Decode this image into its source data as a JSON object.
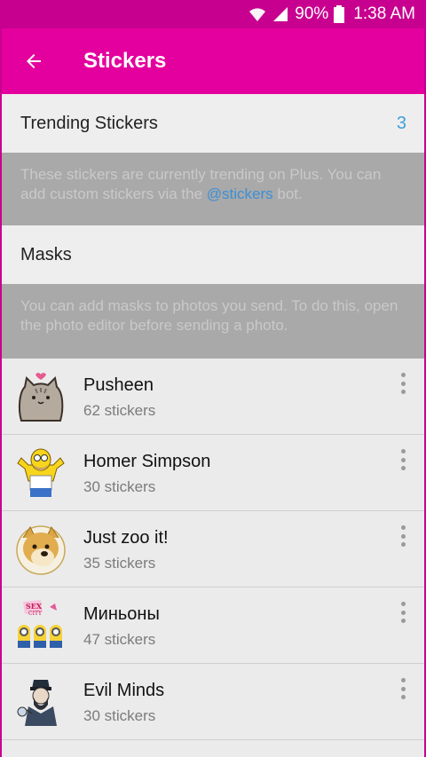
{
  "status": {
    "battery": "90%",
    "time": "1:38 AM"
  },
  "appbar": {
    "title": "Stickers"
  },
  "trending": {
    "label": "Trending Stickers",
    "count": "3"
  },
  "trending_info": {
    "text_before": "These stickers are currently trending on Plus. You can add custom stickers via the ",
    "link": "@stickers",
    "text_after": " bot."
  },
  "masks": {
    "label": "Masks"
  },
  "masks_info": {
    "text": "You can add masks to photos you send. To do this, open the photo editor before sending a photo."
  },
  "packs": [
    {
      "name": "Pusheen",
      "count": "62 stickers",
      "icon": "pusheen-cat-icon"
    },
    {
      "name": "Homer Simpson",
      "count": "30 stickers",
      "icon": "homer-simpson-icon"
    },
    {
      "name": "Just zoo it!",
      "count": "35 stickers",
      "icon": "doge-icon"
    },
    {
      "name": "Миньоны",
      "count": "47 stickers",
      "icon": "minions-icon"
    },
    {
      "name": "Evil Minds",
      "count": "30 stickers",
      "icon": "evil-minds-icon"
    }
  ],
  "colors": {
    "statusbar": "#c8008f",
    "appbar": "#e4009e",
    "accent": "#3fa0d8"
  }
}
